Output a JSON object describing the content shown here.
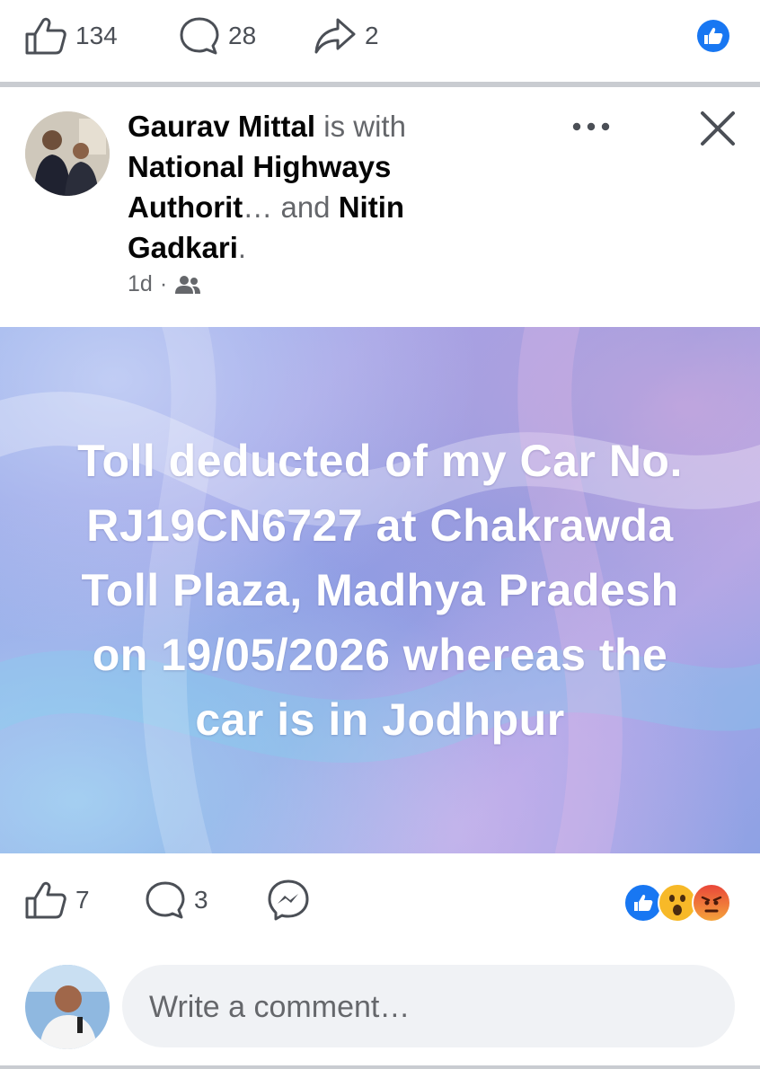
{
  "top_bar": {
    "likes": "134",
    "comments": "28",
    "shares": "2"
  },
  "post": {
    "author": "Gaurav Mittal",
    "with_text": "is with",
    "tag1": "National Highways Authorit",
    "ellipsis": "…",
    "and_text": "and",
    "tag2": "Nitin Gadkari",
    "period": ".",
    "time": "1d",
    "dot": "·",
    "body": "Toll deducted of my Car No. RJ19CN6727 at Chakrawda Toll Plaza, Madhya Pradesh on 19/05/2026 whereas the car is in Jodhpur"
  },
  "bottom_bar": {
    "likes": "7",
    "comments": "3"
  },
  "comment": {
    "placeholder": "Write a comment…"
  },
  "colors": {
    "fb_blue": "#1877f2",
    "icon_gray": "#4b4f56",
    "muted": "#65676b",
    "divider": "#c9ccd1"
  },
  "icons": [
    "thumbs-up-icon",
    "comment-icon",
    "share-icon",
    "like-reaction-icon",
    "more-icon",
    "close-icon",
    "friends-icon",
    "messenger-icon",
    "wow-reaction-icon",
    "angry-reaction-icon"
  ]
}
